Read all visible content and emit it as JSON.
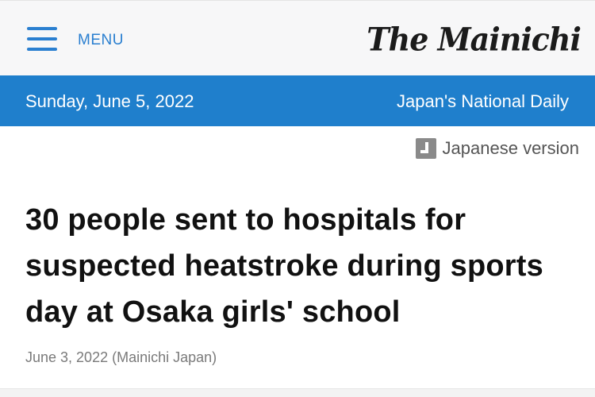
{
  "header": {
    "menu_label": "MENU",
    "menu_icon": "hamburger-icon",
    "logo_text": "The Mainichi"
  },
  "date_band": {
    "date": "Sunday, June 5, 2022",
    "tagline": "Japan's National Daily",
    "background_color": "#1f7fcc"
  },
  "jp_link": {
    "icon": "japanese-version-icon",
    "label": "Japanese version"
  },
  "article": {
    "headline": "30 people sent to hospitals for suspected heatstroke during sports day at Osaka girls' school",
    "byline": "June 3, 2022 (Mainichi Japan)"
  },
  "colors": {
    "accent": "#2a7fd0",
    "band": "#1f7fcc",
    "headline_text": "#111111",
    "muted_text": "#7a7a7a"
  }
}
